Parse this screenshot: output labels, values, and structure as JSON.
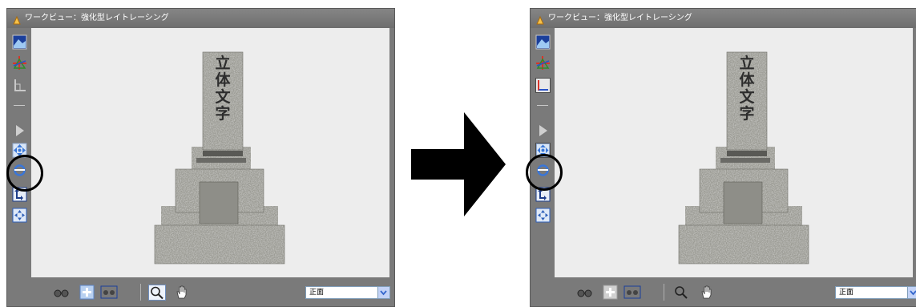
{
  "left_window": {
    "title": "ワークビュー：強化型レイトレーシング",
    "view_select": "正面",
    "highlighted_tool": "pan-move-tool",
    "tool_state": "off"
  },
  "right_window": {
    "title": "ワークビュー：強化型レイトレーシング",
    "view_select": "正面",
    "highlighted_tool": "pan-move-tool",
    "tool_state": "on"
  },
  "monument_text": [
    "立",
    "体",
    "文",
    "字"
  ],
  "colors": {
    "panel": "#7a7a7a",
    "viewport": "#ededed",
    "highlight_ring": "#000000",
    "stone": "#9a9a93"
  },
  "tools": [
    "render-preview-icon",
    "axis-gizmo-icon",
    "corner-axis-icon",
    "line-icon",
    "triangle-icon",
    "pan-move-icon",
    "rotate-view-icon",
    "move-corner-icon",
    "fit-view-icon"
  ]
}
